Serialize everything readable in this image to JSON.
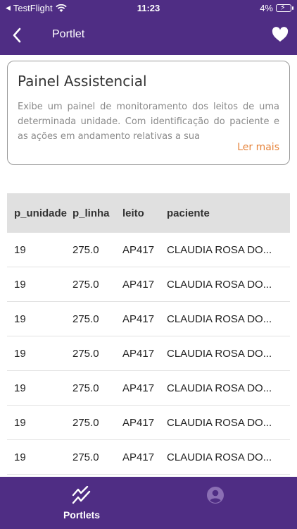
{
  "status_bar": {
    "carrier": "TestFlight",
    "time": "11:23",
    "battery": "4%"
  },
  "navbar": {
    "title": "Portlet"
  },
  "card": {
    "title": "Painel Assistencial",
    "description": "Exibe um painel de monitoramento dos leitos de uma determinada unidade. Com identificação do paciente e as ações em andamento relativas a sua",
    "more_label": "Ler mais"
  },
  "table": {
    "headers": [
      "p_unidade",
      "p_linha",
      "leito",
      "paciente"
    ],
    "rows": [
      [
        "19",
        "275.0",
        "AP417",
        "CLAUDIA ROSA DO..."
      ],
      [
        "19",
        "275.0",
        "AP417",
        "CLAUDIA ROSA DO..."
      ],
      [
        "19",
        "275.0",
        "AP417",
        "CLAUDIA ROSA DO..."
      ],
      [
        "19",
        "275.0",
        "AP417",
        "CLAUDIA ROSA DO..."
      ],
      [
        "19",
        "275.0",
        "AP417",
        "CLAUDIA ROSA DO..."
      ],
      [
        "19",
        "275.0",
        "AP417",
        "CLAUDIA ROSA DO..."
      ],
      [
        "19",
        "275.0",
        "AP417",
        "CLAUDIA ROSA DO..."
      ]
    ]
  },
  "tabbar": {
    "tabs": [
      {
        "label": "Portlets",
        "icon": "trend-chart-icon",
        "active": true
      },
      {
        "label": "",
        "icon": "account-icon",
        "active": false
      }
    ]
  },
  "colors": {
    "primary": "#4f2d84",
    "accent": "#e6833a",
    "header_bg": "#e0e0e0"
  }
}
